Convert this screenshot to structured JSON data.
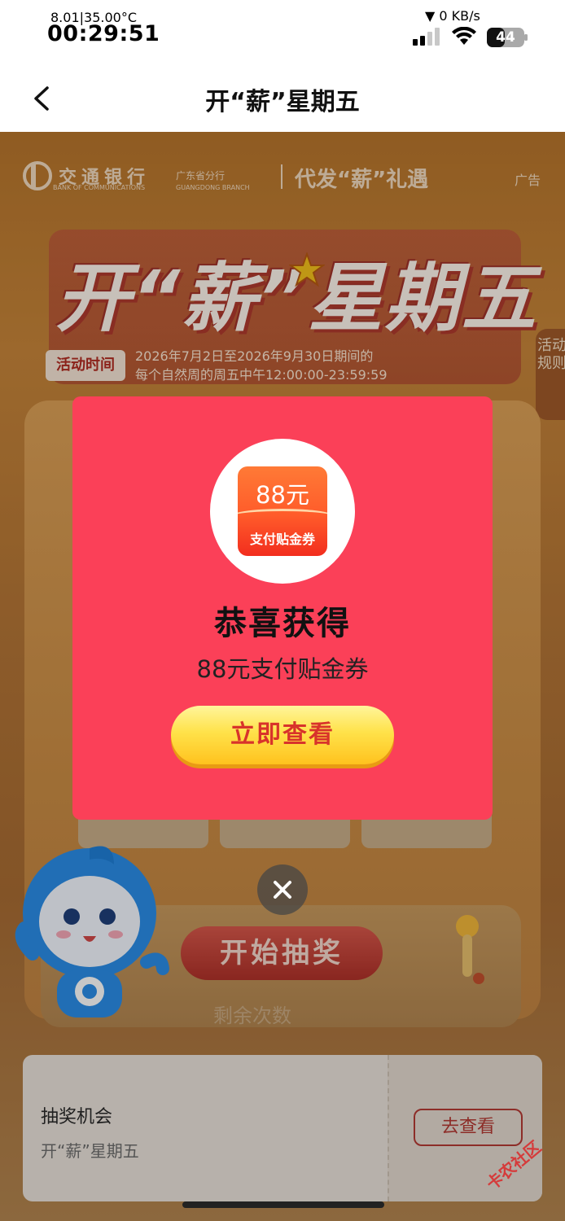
{
  "status_bar": {
    "net_stats": "8.01|35.00°C",
    "time": "00:29:51",
    "speed": "▼ 0 KB/s",
    "battery": "44"
  },
  "navbar": {
    "title": "开“薪”星期五"
  },
  "banner": {
    "bank_name": "交通银行",
    "bank_name_en": "BANK OF COMMUNICATIONS",
    "branch": "广东省分行",
    "branch_en": "GUANGDONG BRANCH",
    "slogan": "代发“薪”礼遇",
    "ad_label": "广告",
    "event_title": "开“薪”星期五",
    "period_label": "活动时间",
    "period_line1": "2026年7月2日至2026年9月30日期间的",
    "period_line2": "每个自然周的周五中午12:00:00-23:59:59",
    "rules_tab": "活动规则"
  },
  "machine": {
    "start_label": "开始抽奖",
    "remaining_label": "剩余次数"
  },
  "bottom_card": {
    "title": "抽奖机会",
    "subtitle": "开“薪”星期五",
    "button_label": "去查看"
  },
  "modal": {
    "coupon_amount": "88元",
    "coupon_label": "支付贴金券",
    "heading": "恭喜获得",
    "prize": "88元支付贴金券",
    "cta_label": "立即查看"
  },
  "watermark": "卡农社区",
  "colors": {
    "modal_bg": "#fb4058",
    "cta_text": "#d8332b",
    "cta_bg": "#ffe24a"
  }
}
